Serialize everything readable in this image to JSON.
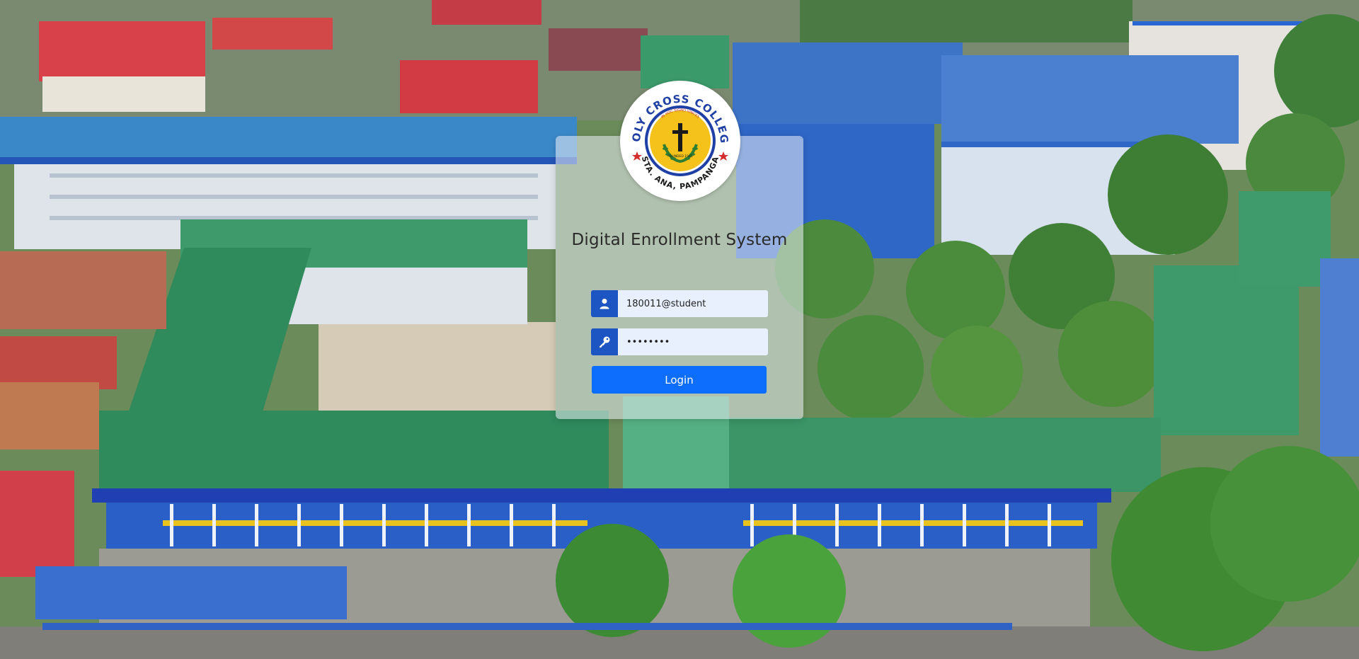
{
  "logo": {
    "name_text": "HOLY CROSS COLLEGE",
    "motto_text": "IN HOC SIGNO VINCES",
    "founded_text": "FOUNDED 1945",
    "location_text": "STA. ANA, PAMPANGA",
    "colors": {
      "ring_text": "#1e3fa3",
      "inner_ring": "#1e3fa3",
      "center_fill": "#f4c21a",
      "laurel": "#2e7d32",
      "cross": "#1a1a1a",
      "stars": "#d32f2f"
    }
  },
  "login": {
    "title": "Digital Enrollment System",
    "username_value": "180011@student",
    "password_value": "12345678",
    "username_icon": "user-icon",
    "password_icon": "key-icon",
    "button_label": "Login"
  },
  "colors": {
    "addon_bg": "#1d56c2",
    "button_bg": "#0d6efd",
    "input_bg": "#e8f0fe"
  },
  "background": {
    "description_icon": "campus-aerial-photo"
  }
}
